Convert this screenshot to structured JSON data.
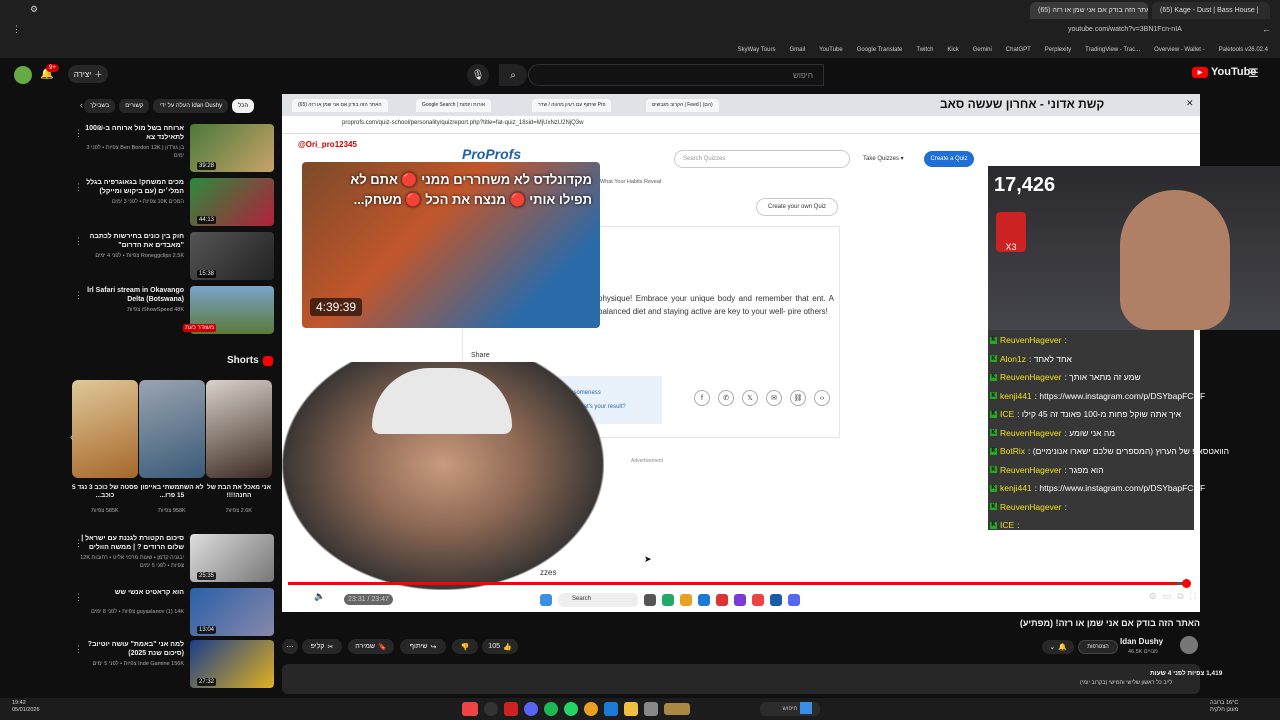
{
  "browser": {
    "tabs": [
      {
        "label": "(65) Kage - Dust | Bass House |"
      },
      {
        "label": "האתר הזה בודק אם אני שמן או רזה (65)"
      }
    ],
    "url": "youtube.com/watch?v=3BN1Fcn-nIA",
    "bookmarks": [
      "Paletools v26.02.4",
      "Overview - Wallet -",
      "TradingView - Trac...",
      "Perplexity",
      "ChatGPT",
      "Gemini",
      "Kick",
      "Twitch",
      "Google Translate",
      "YouTube",
      "Gmail",
      "SkyWay Tours"
    ]
  },
  "yt_header": {
    "search_placeholder": "חיפוש",
    "search_value": "",
    "logo_text": "YouTube",
    "create_label": "יצירה",
    "notif_count": "9+"
  },
  "chips": [
    "הכל",
    "העלה על ידי Idan Dushy",
    "קשורים",
    "בשבילך"
  ],
  "recommendations": [
    {
      "title": "ארוחה בשל מול ארוחה ב-100₪ לתאילנד צא",
      "meta": "בן גורדון | Ben Bordon\n12K צפיות • לפני 3 ימים",
      "duration": "39:28"
    },
    {
      "title": "מכים המשחק! בגאוגרפיה בגלל המלי׳ים (עם ביקוש ומייקל)",
      "meta": "המכים\n10K צפיות • לפני 3 ימים",
      "duration": "44:13"
    },
    {
      "title": "חוק בין כונים בחירשות לכתבה \"מאבדים את הדרום\"",
      "meta": "Roneggclips\n2.5K צפיות • לפני 4 ימים",
      "duration": "15:38"
    },
    {
      "title": "lrl Safari stream in Okavango Delta (Botswana)",
      "meta": "iShowSpeed\n48K צפיות",
      "duration": "משודר כעת"
    },
    {
      "title": "סיכום הקטורת לגננת עם ישראל | שלום הרודים ? | ממשה הוולים",
      "meta": "יבגניה קדמן • שעות מרכזי אליט • רחובות\n12K צפיות • לפני 5 ימים",
      "duration": "25:35"
    },
    {
      "title": "הוא קראטיט אנשי שש",
      "meta": "guyaslanov\n(1) 14K צפיות • לפני 8 ימים",
      "duration": "13:04"
    },
    {
      "title": "למה אני \"באמת\" עושה יוטיוב? (סיכום שנת 2025)",
      "meta": "Inde Gamine\n156K צפיות • לפני 5 ימים",
      "duration": "27:32"
    }
  ],
  "shorts": {
    "heading": "Shorts",
    "items": [
      {
        "title": "אני מאכל את הבת של החנה!!!!",
        "views": "2.6K צפיות"
      },
      {
        "title": "לא השתמשתי באייפון 15 פרו...",
        "views": "958K צפיות"
      },
      {
        "title": "פסטה של כוכב 3 נגד 5 כוכב...",
        "views": "585K צפיות"
      }
    ]
  },
  "player": {
    "inner_tabs": [
      "(65) האתר הזה בודק אם אני שמן או רזה",
      "Google Search | אורות ויזמות",
      "שיתוף עם רעיון מהווה / שדר Pro",
      "הקרוב מגבשים | Feed | (הם)"
    ],
    "overlay_top_title": "קשת אדוני - אחרון שעשה סאב",
    "inner_url": "proprofs.com/quiz-school/personality/quizreport.php?title=fat-quiz_18sid=MjUxNzU2NjQ3w",
    "proprofs_logo": "ProProfs",
    "pp_search_placeholder": "Search Quizzes",
    "pp_take": "Take Quizzes ▾",
    "pp_create": "Create a Quiz",
    "pp_own": "Create your own Quiz",
    "pp_habits": "What Your Habits Reveal",
    "pp_result": "physique! Embrace your unique body and remember that ent. A balanced diet and staying active are key to your well- pire others!",
    "pp_share": "Share",
    "pp_spread_title": "Spread the Awesomeness",
    "pp_spread_sub": "Physique - Feeling great! What's your result?",
    "pp_ad": "Advertisement",
    "pp_quizzes": "zzes",
    "overlay_channel": "@Ori_pro12345",
    "overlay_line1": "מקדונלדס לא משחררים ממני 🔴 אתם לא",
    "overlay_line2": "תפילו אותי 🔴 מנצח את הכל 🔴 משחק...",
    "overlay_duration": "4:39:39",
    "viewer_count": "17,426",
    "cam_badge_text": "X3",
    "time": "23:31 / 23:47",
    "taskbar_search": "Search",
    "progress": 0.99
  },
  "chat": [
    {
      "user": "ReuvenHagever",
      "text": ":"
    },
    {
      "user": "Alon1z",
      "text": ": אחד לאחד"
    },
    {
      "user": "ReuvenHagever",
      "text": ": שמע זה מתאר אותך"
    },
    {
      "user": "kenji441",
      "text": ": https://www.instagram.com/p/DSYbapFCtcF"
    },
    {
      "user": "ICE",
      "text": ": איך אתה שוקל פחות מ-100 פאונד זה 45 קילו"
    },
    {
      "user": "ReuvenHagever",
      "text": ": מה אני שומע"
    },
    {
      "user": "BotRix",
      "text": ": הוואטסאפ של הערוץ (המספרים שלכם ישארו אנונימיים)"
    },
    {
      "user": "ReuvenHagever",
      "text": ": הוא מפגר"
    },
    {
      "user": "kenji441",
      "text": ": https://www.instagram.com/p/DSYbapFCtcF"
    },
    {
      "user": "ReuvenHagever",
      "text": ":"
    },
    {
      "user": "ICE",
      "text": ":"
    }
  ],
  "below": {
    "title": "האתר הזה בודק אם אני שמן או רזה! (מפתיע)",
    "channel": "Idan Dushy",
    "subs": "46.5K מנויים",
    "join": "הצטרפות",
    "likes": "105",
    "share": "שיתוף",
    "save": "שמירה",
    "clip": "קליפ",
    "views_line": "1,419 צפיות לפני 4 שעות",
    "desc_line": "לייב כל ראשון שלישי וחמישי (בקרוב יומי)"
  },
  "taskbar": {
    "clock": "19:42\n05/01/2026",
    "weather": "16°C ברובה\nמעונן חלקית",
    "search": "חיפוש"
  },
  "colors": {
    "accent": "#ff0000",
    "pp_blue": "#1f6fd6",
    "chat_user": "#f0e020"
  }
}
